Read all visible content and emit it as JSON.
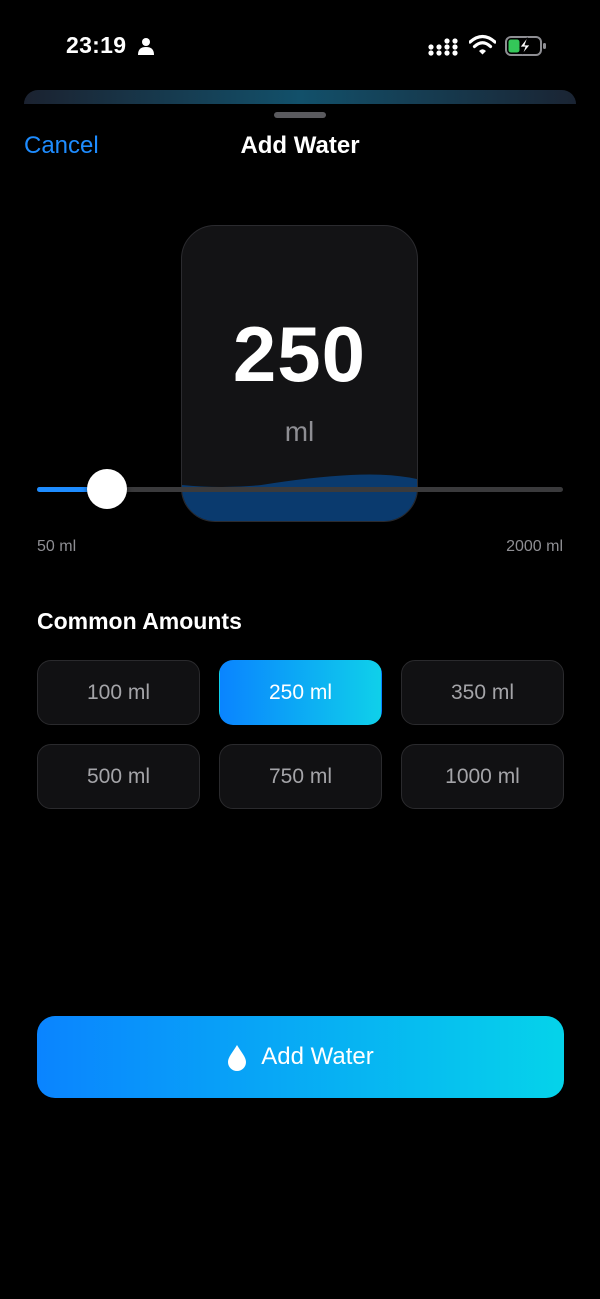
{
  "status_bar": {
    "time": "23:19",
    "icons": [
      "person-icon",
      "signal-icon",
      "wifi-icon",
      "battery-charging-icon"
    ]
  },
  "header": {
    "cancel_label": "Cancel",
    "title": "Add Water"
  },
  "amount": {
    "value": "250",
    "unit": "ml"
  },
  "slider": {
    "min_label": "50 ml",
    "max_label": "2000 ml",
    "min": 50,
    "max": 2000,
    "value": 250
  },
  "common_amounts": {
    "title": "Common Amounts",
    "options": [
      {
        "label": "100 ml",
        "selected": false
      },
      {
        "label": "250 ml",
        "selected": true
      },
      {
        "label": "350 ml",
        "selected": false
      },
      {
        "label": "500 ml",
        "selected": false
      },
      {
        "label": "750 ml",
        "selected": false
      },
      {
        "label": "1000 ml",
        "selected": false
      }
    ]
  },
  "add_button": {
    "label": "Add Water",
    "icon": "water-drop-icon"
  },
  "colors": {
    "accent": "#0a84ff",
    "accent_end": "#0fd0ea",
    "background": "#000000",
    "card": "#131315",
    "water": "#0a3a6e"
  }
}
